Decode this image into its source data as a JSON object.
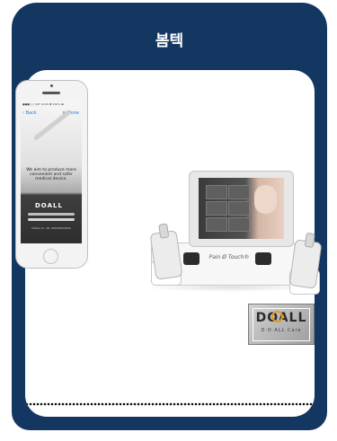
{
  "header": {
    "title": "봄텍"
  },
  "phone": {
    "status_bar": "●●●○○ SKT  12:00  ✱ 100% ▬",
    "back_label": "Back",
    "close_label": "✕ Done",
    "headline": "We aim to produce more convenient and safer medical device.",
    "logo": "DOALL",
    "footer_text": "DOALL Inc. Tel. 000-0000-0000"
  },
  "product": {
    "brand": "Pain Ø Touch®"
  },
  "badge": {
    "logo": "DOALL",
    "tagline": "D·O·ALL Care"
  },
  "colors": {
    "card_background": "#143761",
    "badge_ring": "#e39a22"
  }
}
